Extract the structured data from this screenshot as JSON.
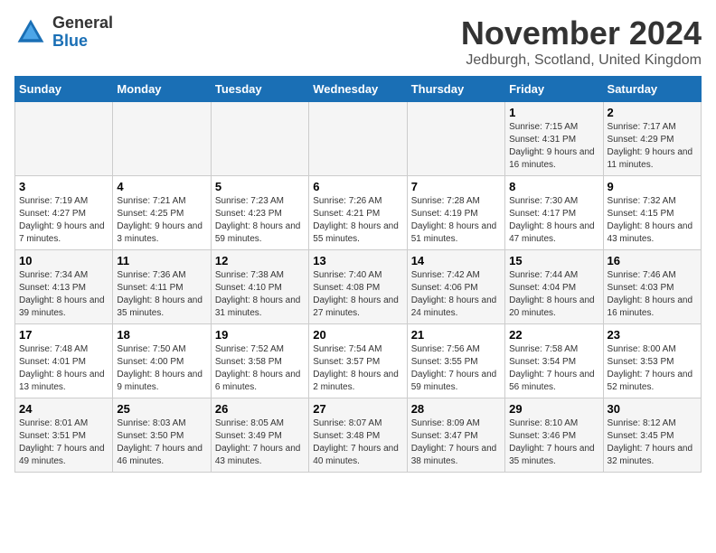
{
  "logo": {
    "general": "General",
    "blue": "Blue"
  },
  "header": {
    "month": "November 2024",
    "location": "Jedburgh, Scotland, United Kingdom"
  },
  "weekdays": [
    "Sunday",
    "Monday",
    "Tuesday",
    "Wednesday",
    "Thursday",
    "Friday",
    "Saturday"
  ],
  "weeks": [
    [
      {
        "day": "",
        "info": ""
      },
      {
        "day": "",
        "info": ""
      },
      {
        "day": "",
        "info": ""
      },
      {
        "day": "",
        "info": ""
      },
      {
        "day": "",
        "info": ""
      },
      {
        "day": "1",
        "info": "Sunrise: 7:15 AM\nSunset: 4:31 PM\nDaylight: 9 hours and 16 minutes."
      },
      {
        "day": "2",
        "info": "Sunrise: 7:17 AM\nSunset: 4:29 PM\nDaylight: 9 hours and 11 minutes."
      }
    ],
    [
      {
        "day": "3",
        "info": "Sunrise: 7:19 AM\nSunset: 4:27 PM\nDaylight: 9 hours and 7 minutes."
      },
      {
        "day": "4",
        "info": "Sunrise: 7:21 AM\nSunset: 4:25 PM\nDaylight: 9 hours and 3 minutes."
      },
      {
        "day": "5",
        "info": "Sunrise: 7:23 AM\nSunset: 4:23 PM\nDaylight: 8 hours and 59 minutes."
      },
      {
        "day": "6",
        "info": "Sunrise: 7:26 AM\nSunset: 4:21 PM\nDaylight: 8 hours and 55 minutes."
      },
      {
        "day": "7",
        "info": "Sunrise: 7:28 AM\nSunset: 4:19 PM\nDaylight: 8 hours and 51 minutes."
      },
      {
        "day": "8",
        "info": "Sunrise: 7:30 AM\nSunset: 4:17 PM\nDaylight: 8 hours and 47 minutes."
      },
      {
        "day": "9",
        "info": "Sunrise: 7:32 AM\nSunset: 4:15 PM\nDaylight: 8 hours and 43 minutes."
      }
    ],
    [
      {
        "day": "10",
        "info": "Sunrise: 7:34 AM\nSunset: 4:13 PM\nDaylight: 8 hours and 39 minutes."
      },
      {
        "day": "11",
        "info": "Sunrise: 7:36 AM\nSunset: 4:11 PM\nDaylight: 8 hours and 35 minutes."
      },
      {
        "day": "12",
        "info": "Sunrise: 7:38 AM\nSunset: 4:10 PM\nDaylight: 8 hours and 31 minutes."
      },
      {
        "day": "13",
        "info": "Sunrise: 7:40 AM\nSunset: 4:08 PM\nDaylight: 8 hours and 27 minutes."
      },
      {
        "day": "14",
        "info": "Sunrise: 7:42 AM\nSunset: 4:06 PM\nDaylight: 8 hours and 24 minutes."
      },
      {
        "day": "15",
        "info": "Sunrise: 7:44 AM\nSunset: 4:04 PM\nDaylight: 8 hours and 20 minutes."
      },
      {
        "day": "16",
        "info": "Sunrise: 7:46 AM\nSunset: 4:03 PM\nDaylight: 8 hours and 16 minutes."
      }
    ],
    [
      {
        "day": "17",
        "info": "Sunrise: 7:48 AM\nSunset: 4:01 PM\nDaylight: 8 hours and 13 minutes."
      },
      {
        "day": "18",
        "info": "Sunrise: 7:50 AM\nSunset: 4:00 PM\nDaylight: 8 hours and 9 minutes."
      },
      {
        "day": "19",
        "info": "Sunrise: 7:52 AM\nSunset: 3:58 PM\nDaylight: 8 hours and 6 minutes."
      },
      {
        "day": "20",
        "info": "Sunrise: 7:54 AM\nSunset: 3:57 PM\nDaylight: 8 hours and 2 minutes."
      },
      {
        "day": "21",
        "info": "Sunrise: 7:56 AM\nSunset: 3:55 PM\nDaylight: 7 hours and 59 minutes."
      },
      {
        "day": "22",
        "info": "Sunrise: 7:58 AM\nSunset: 3:54 PM\nDaylight: 7 hours and 56 minutes."
      },
      {
        "day": "23",
        "info": "Sunrise: 8:00 AM\nSunset: 3:53 PM\nDaylight: 7 hours and 52 minutes."
      }
    ],
    [
      {
        "day": "24",
        "info": "Sunrise: 8:01 AM\nSunset: 3:51 PM\nDaylight: 7 hours and 49 minutes."
      },
      {
        "day": "25",
        "info": "Sunrise: 8:03 AM\nSunset: 3:50 PM\nDaylight: 7 hours and 46 minutes."
      },
      {
        "day": "26",
        "info": "Sunrise: 8:05 AM\nSunset: 3:49 PM\nDaylight: 7 hours and 43 minutes."
      },
      {
        "day": "27",
        "info": "Sunrise: 8:07 AM\nSunset: 3:48 PM\nDaylight: 7 hours and 40 minutes."
      },
      {
        "day": "28",
        "info": "Sunrise: 8:09 AM\nSunset: 3:47 PM\nDaylight: 7 hours and 38 minutes."
      },
      {
        "day": "29",
        "info": "Sunrise: 8:10 AM\nSunset: 3:46 PM\nDaylight: 7 hours and 35 minutes."
      },
      {
        "day": "30",
        "info": "Sunrise: 8:12 AM\nSunset: 3:45 PM\nDaylight: 7 hours and 32 minutes."
      }
    ]
  ]
}
